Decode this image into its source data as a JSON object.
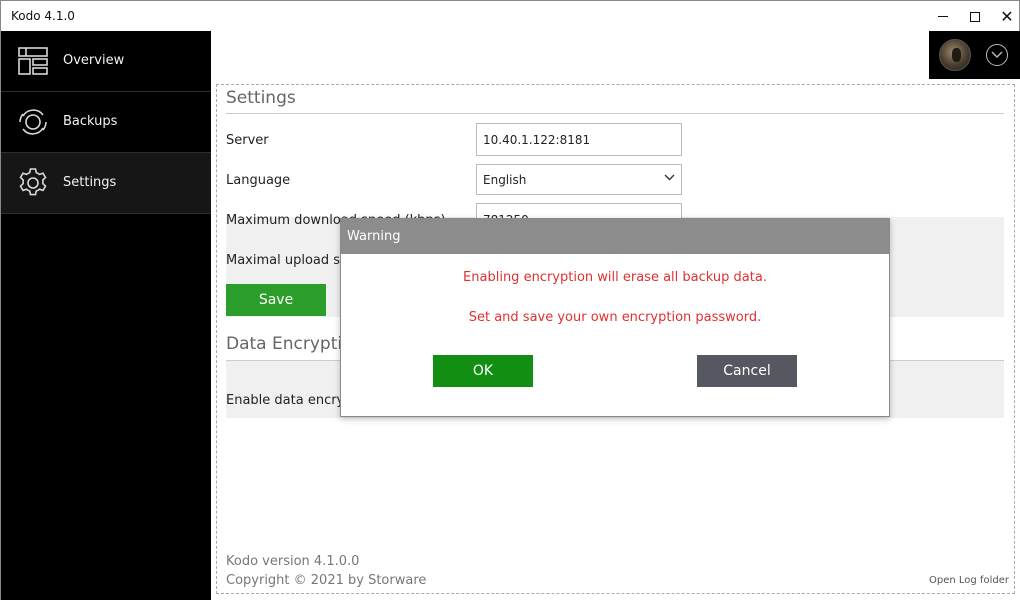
{
  "window": {
    "title": "Kodo 4.1.0",
    "controls": [
      "minimize-icon",
      "maximize-icon",
      "close-icon"
    ]
  },
  "sidebar": {
    "items": [
      {
        "label": "Overview",
        "icon": "dashboard-icon",
        "active": false
      },
      {
        "label": "Backups",
        "icon": "backup-sync-icon",
        "active": false
      },
      {
        "label": "Settings",
        "icon": "gear-icon",
        "active": true
      }
    ]
  },
  "user": {
    "avatar": "avatar",
    "menu_icon": "chevron-down-icon"
  },
  "settings": {
    "title": "Settings",
    "server_label": "Server",
    "server_value": "10.40.1.122:8181",
    "language_label": "Language",
    "language_value": "English",
    "max_download_label": "Maximum download speed (kbps)",
    "max_download_value": "781250",
    "max_upload_label": "Maximal upload speed (kbps)",
    "save_label": "Save"
  },
  "encryption": {
    "title": "Data Encryption",
    "enable_label": "Enable data encryption"
  },
  "footer": {
    "version": "Kodo version 4.1.0.0",
    "copyright": "Copyright © 2021 by Storware",
    "open_log": "Open Log folder"
  },
  "dialog": {
    "title": "Warning",
    "message1": "Enabling encryption will erase all backup data.",
    "message2": "Set and save your own encryption password.",
    "ok_label": "OK",
    "cancel_label": "Cancel"
  },
  "colors": {
    "sidebar_bg": "#000000",
    "save_button": "#2a9d2a",
    "ok_button": "#128e12",
    "cancel_button": "#555860",
    "dialog_header": "#8c8c8c",
    "warning_text": "#e03030"
  }
}
